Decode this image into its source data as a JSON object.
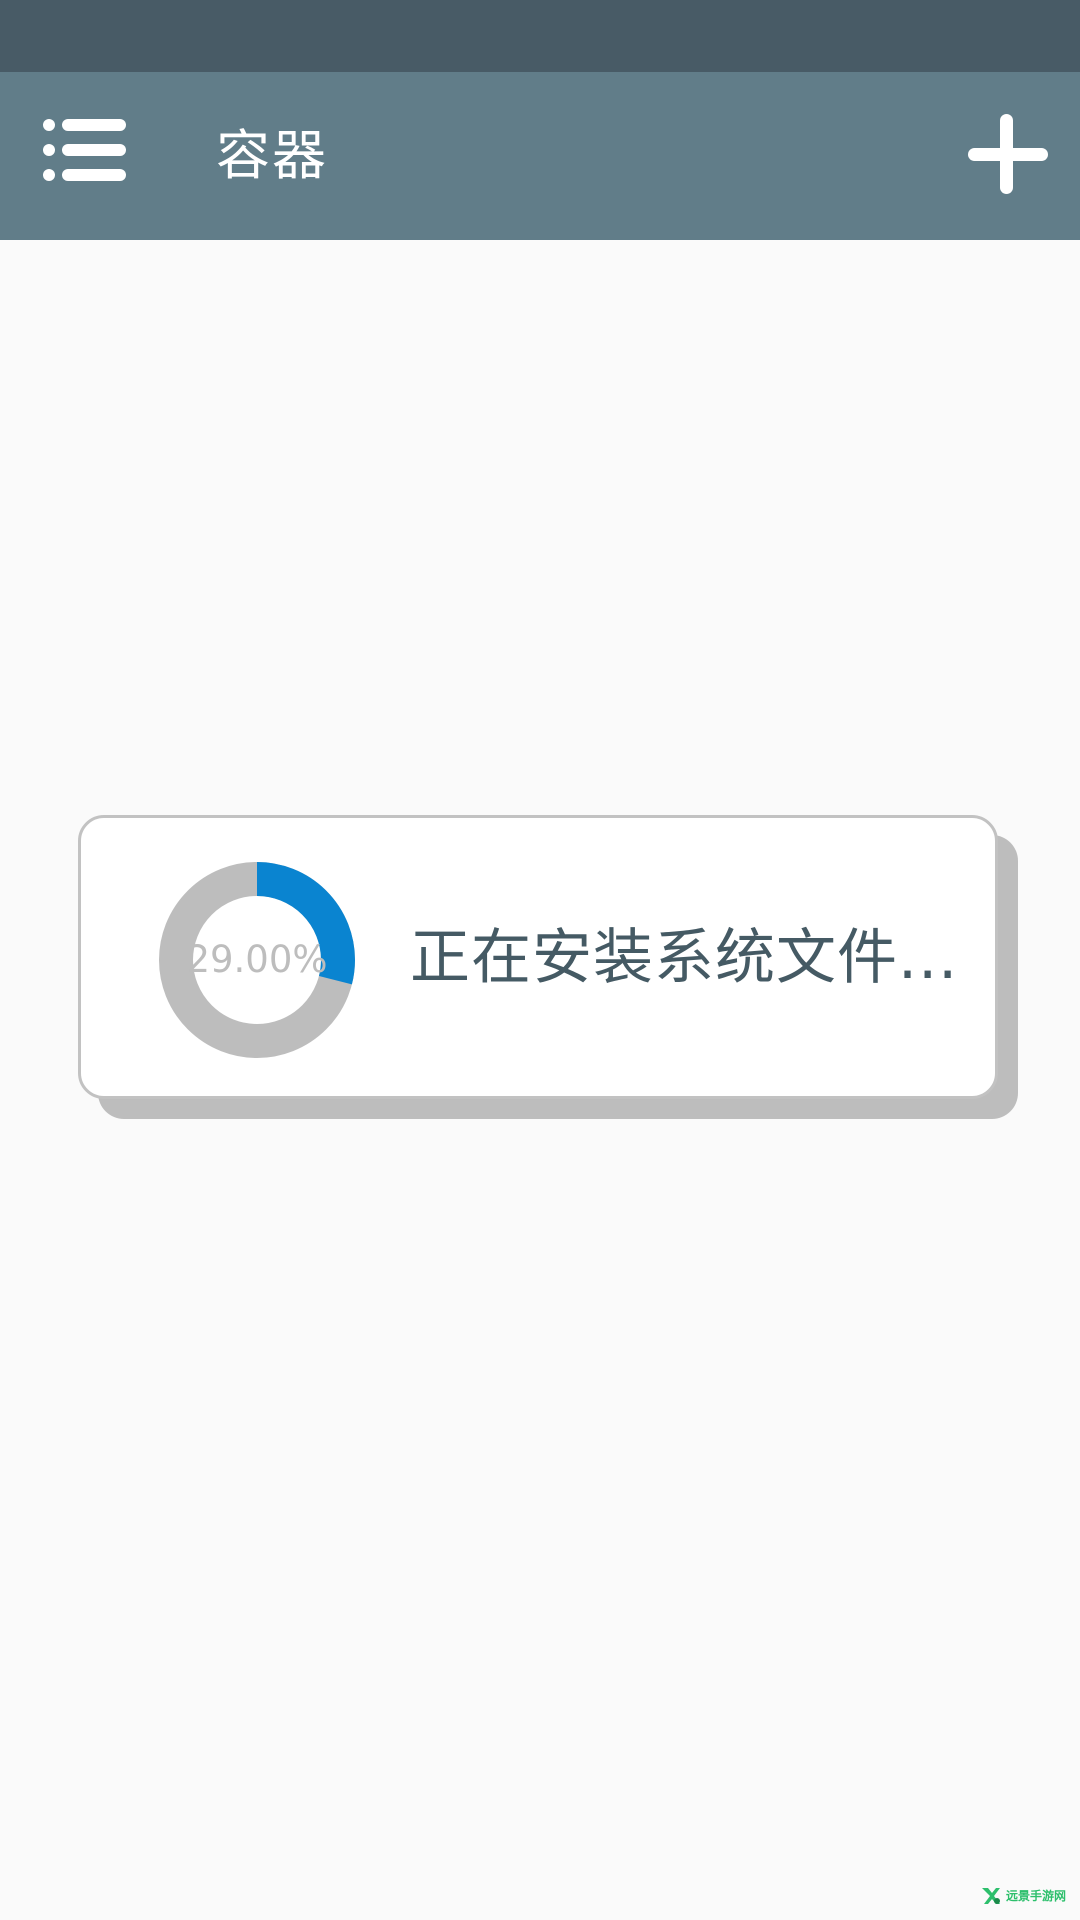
{
  "app_bar": {
    "title": "容器",
    "menu_icon": "menu-list-icon",
    "add_icon": "plus-icon"
  },
  "dialog": {
    "progress": {
      "value": 0.29,
      "label": "29.00%"
    },
    "message": "正在安装系统文件..."
  },
  "watermark": {
    "text": "远景手游网"
  },
  "colors": {
    "status_bar": "#485b66",
    "app_bar": "#617d89",
    "progress_fill": "#0a84d0",
    "progress_track": "#bdbdbd",
    "message_text": "#455a64"
  }
}
